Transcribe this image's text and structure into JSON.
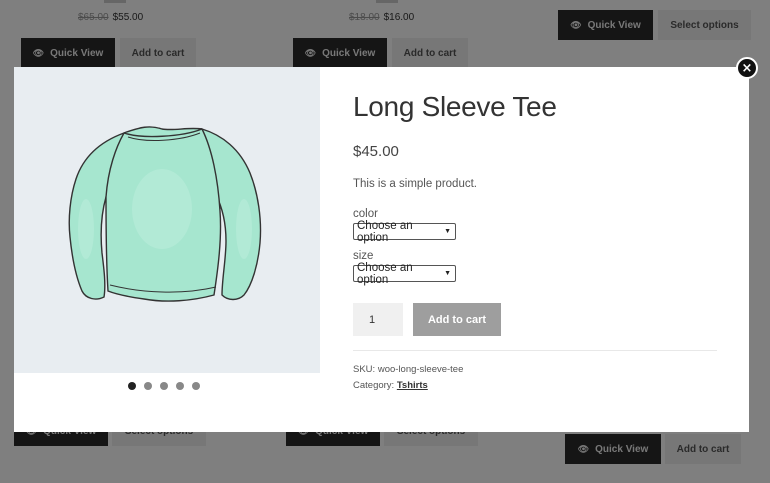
{
  "background": {
    "products_top": [
      {
        "old_price": "$65.00",
        "price": "$55.00",
        "btn1": "Quick View",
        "btn2": "Add to cart"
      },
      {
        "old_price": "$18.00",
        "price": "$16.00",
        "btn1": "Quick View",
        "btn2": "Add to cart"
      },
      {
        "btn1": "Quick View",
        "btn2": "Select options"
      }
    ],
    "products_bottom": [
      {
        "btn1": "Quick View",
        "btn2": "Select options"
      },
      {
        "btn1": "Quick View",
        "btn2": "Select options"
      },
      {
        "btn1": "Quick View",
        "btn2": "Add to cart"
      }
    ]
  },
  "modal": {
    "close": "×",
    "title": "Long Sleeve Tee",
    "price": "$45.00",
    "description": "This is a simple product.",
    "attributes": [
      {
        "label": "color",
        "selected": "Choose an option"
      },
      {
        "label": "size",
        "selected": "Choose an option"
      }
    ],
    "quantity": "1",
    "add_to_cart": "Add to cart",
    "sku_label": "SKU:",
    "sku": "woo-long-sleeve-tee",
    "category_label": "Category:",
    "category": "Tshirts",
    "gallery_count": 5,
    "gallery_active": 1,
    "image_icon": "long-sleeve-shirt"
  },
  "colors": {
    "overlay": "#000000",
    "shirt": "#a6e6cf",
    "dark_button": "#2b2b2b",
    "add_button": "#9e9e9e"
  }
}
